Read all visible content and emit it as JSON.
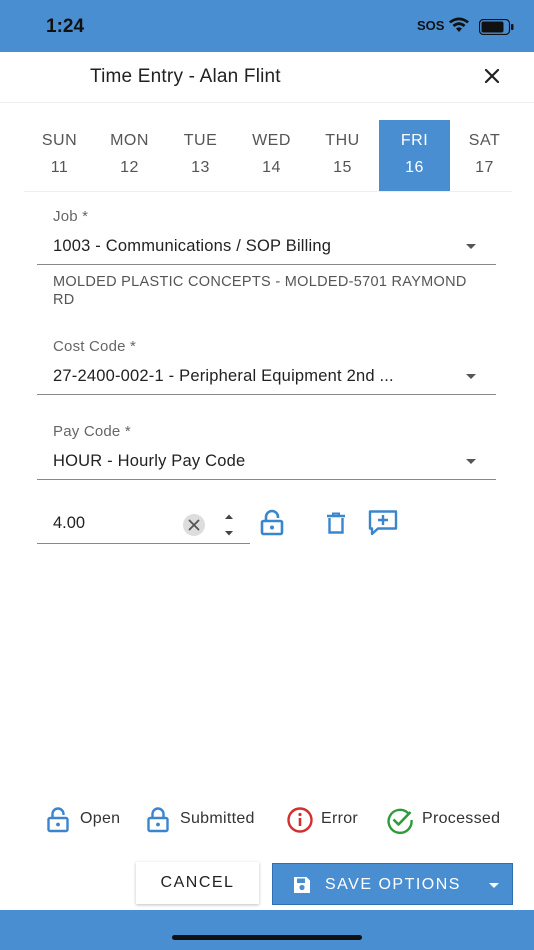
{
  "status": {
    "time": "1:24",
    "sos": "SOS"
  },
  "header": {
    "title": "Time Entry - Alan Flint"
  },
  "days": [
    {
      "name": "SUN",
      "date": "11"
    },
    {
      "name": "MON",
      "date": "12"
    },
    {
      "name": "TUE",
      "date": "13"
    },
    {
      "name": "WED",
      "date": "14"
    },
    {
      "name": "THU",
      "date": "15"
    },
    {
      "name": "FRI",
      "date": "16"
    },
    {
      "name": "SAT",
      "date": "17"
    }
  ],
  "selected_day": "FRI",
  "form": {
    "job_label": "Job *",
    "job_value": "1003 - Communications / SOP Billing",
    "job_address": "MOLDED PLASTIC CONCEPTS - MOLDED-5701 RAYMOND RD",
    "cost_code_label": "Cost Code *",
    "cost_code_value": "27-2400-002-1 - Peripheral Equipment 2nd ...",
    "pay_code_label": "Pay Code *",
    "pay_code_value": "HOUR - Hourly Pay Code",
    "hours_value": "4.00"
  },
  "legend": {
    "open": "Open",
    "submitted": "Submitted",
    "error": "Error",
    "processed": "Processed"
  },
  "actions": {
    "cancel": "CANCEL",
    "save_options": "SAVE OPTIONS"
  },
  "colors": {
    "accent": "#4a8ed2",
    "error": "#d32f2f",
    "processed": "#2e9a3a"
  },
  "icons": [
    "close-icon",
    "unlock-icon",
    "trash-icon",
    "add-comment-icon",
    "lock-icon",
    "error-icon",
    "check-circle-icon",
    "save-icon"
  ]
}
